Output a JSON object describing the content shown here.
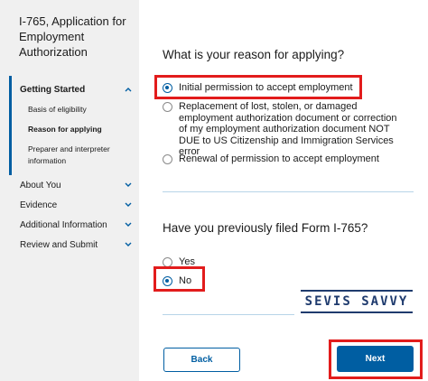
{
  "sidebar": {
    "form_title": "I-765, Application for Employment Authorization",
    "sections": {
      "getting_started": {
        "label": "Getting Started",
        "items": [
          "Basis of eligibility",
          "Reason for applying",
          "Preparer and interpreter information"
        ]
      },
      "about_you": {
        "label": "About You"
      },
      "evidence": {
        "label": "Evidence"
      },
      "additional_information": {
        "label": "Additional Information"
      },
      "review_and_submit": {
        "label": "Review and Submit"
      }
    }
  },
  "main": {
    "reason": {
      "question": "What is your reason for applying?",
      "options": [
        {
          "label": "Initial permission to accept employment",
          "selected": true
        },
        {
          "label": "Replacement of lost, stolen, or damaged employment authorization document or correction of my employment authorization document NOT DUE to US Citizenship and Immigration Services error",
          "selected": false
        },
        {
          "label": "Renewal of permission to accept employment",
          "selected": false
        }
      ]
    },
    "previously_filed": {
      "question": "Have you previously filed Form I-765?",
      "options": [
        {
          "label": "Yes",
          "selected": false
        },
        {
          "label": "No",
          "selected": true
        }
      ]
    },
    "back_label": "Back",
    "next_label": "Next"
  },
  "watermark": {
    "text": "SEVIS SAVVY"
  },
  "colors": {
    "accent": "#005ea2",
    "highlight": "#e21c1c",
    "sidebar_bg": "#f0f0f0",
    "watermark": "#1f3b6e"
  }
}
